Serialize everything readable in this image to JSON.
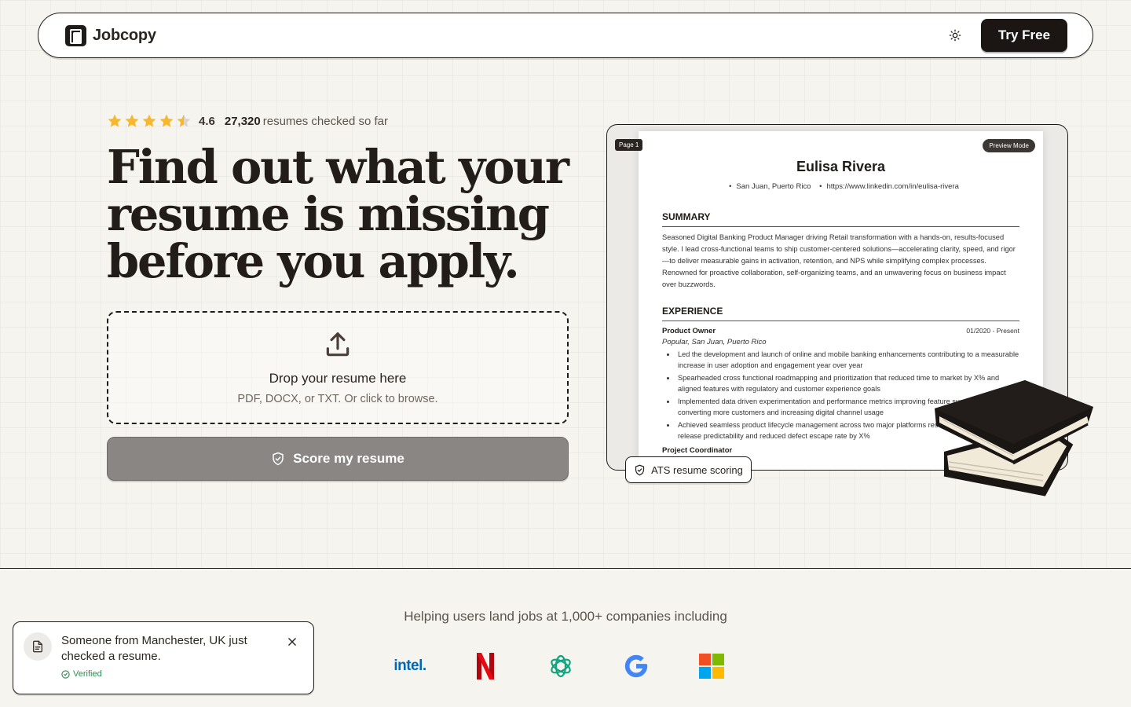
{
  "header": {
    "brand": "Jobcopy",
    "cta_label": "Try Free"
  },
  "hero": {
    "rating_value": "4.6",
    "rating_stars": 4.5,
    "checked_count": "27,320",
    "checked_text": "resumes checked so far",
    "headline_line1": "Find out what your",
    "headline_line2": "resume is missing",
    "headline_line3": "before you apply.",
    "dropzone_title": "Drop your resume here",
    "dropzone_sub": "PDF, DOCX, or TXT. Or click to browse.",
    "score_button": "Score my resume"
  },
  "preview": {
    "page_tag": "Page 1",
    "mode_tag": "Preview Mode",
    "name": "Eulisa Rivera",
    "location": "San Juan, Puerto Rico",
    "link": "https://www.linkedin.com/in/eulisa-rivera",
    "summary_heading": "SUMMARY",
    "summary": "Seasoned Digital Banking Product Manager driving Retail transformation with a hands-on, results-focused style. I lead cross-functional teams to ship customer-centered solutions—accelerating clarity, speed, and rigor—to deliver measurable gains in activation, retention, and NPS while simplifying complex processes. Renowned for proactive collaboration, self-organizing teams, and an unwavering focus on business impact over buzzwords.",
    "experience_heading": "EXPERIENCE",
    "role": "Product Owner",
    "dates": "01/2020 - Present",
    "company": "Popular, San Juan, Puerto Rico",
    "bullets": [
      "Led the development and launch of online and mobile banking enhancements contributing to a measurable increase in user adoption and engagement year over year",
      "Spearheaded cross functional roadmapping and prioritization that reduced time to market by X% and aligned features with regulatory and customer experience goals",
      "Implemented data driven experimentation and performance metrics improving feature success rates by converting more customers and increasing digital channel usage",
      "Achieved seamless product lifecycle management across two major platforms resulting in improved release predictability and reduced defect escape rate by X%"
    ],
    "next_role": "Project Coordinator",
    "ats_badge": "ATS resume scoring"
  },
  "companies": {
    "title": "Helping users land jobs at 1,000+ companies including",
    "intel": "intel."
  },
  "toast": {
    "message": "Someone from Manchester, UK just checked a resume.",
    "verified": "Verified"
  },
  "colors": {
    "background": "#f6f4ef",
    "ink": "#1f1b18",
    "star": "#f5b82e",
    "score_button": "#8a8683",
    "verified": "#2f8a52"
  }
}
